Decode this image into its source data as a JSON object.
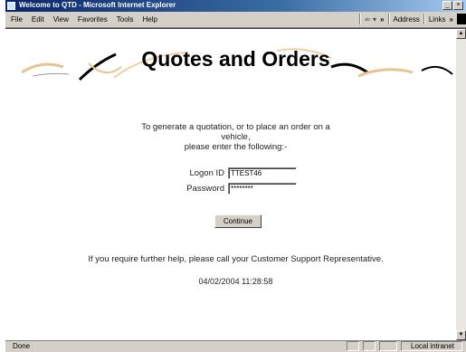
{
  "window": {
    "title": "Welcome to QTD - Microsoft Internet Explorer",
    "controls": {
      "minimize": "_",
      "close": "×"
    }
  },
  "menu": [
    "File",
    "Edit",
    "View",
    "Favorites",
    "Tools",
    "Help"
  ],
  "toolbar": {
    "back": "⇐ ▾",
    "chevron": "»",
    "address_label": "Address",
    "links_label": "Links",
    "links_chevron": "»"
  },
  "page": {
    "heading": "Quotes and Orders",
    "intro_lines": [
      "To generate a quotation, or to place an order on a",
      "vehicle,",
      "please enter the following:-"
    ],
    "logon_label": "Logon ID",
    "logon_value": "TTEST46",
    "password_label": "Password",
    "password_value": "********",
    "continue_label": "Continue",
    "help_text": "If you require further help, please call your Customer Support Representative.",
    "timestamp": "04/02/2004 11:28:58"
  },
  "status": {
    "text": "Done",
    "zone": "Local intranet"
  }
}
